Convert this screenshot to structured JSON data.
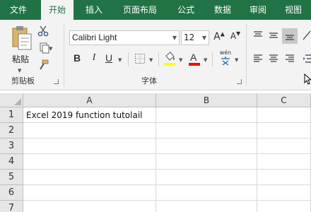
{
  "tabs": [
    {
      "label": "文件",
      "active": false
    },
    {
      "label": "开始",
      "active": true
    },
    {
      "label": "插入",
      "active": false
    },
    {
      "label": "页面布局",
      "active": false
    },
    {
      "label": "公式",
      "active": false
    },
    {
      "label": "数据",
      "active": false
    },
    {
      "label": "审阅",
      "active": false
    },
    {
      "label": "视图",
      "active": false
    }
  ],
  "clipboard": {
    "paste_label": "粘贴",
    "group_label": "剪贴板"
  },
  "font": {
    "family_value": "Calibri Light",
    "size_value": "12",
    "phonetic_label": "wén",
    "group_label": "字体",
    "highlight_color": "#ffff00",
    "font_color": "#ff0000"
  },
  "grid": {
    "columns": [
      "A",
      "B",
      "C"
    ],
    "rows": [
      "1",
      "2",
      "3",
      "4",
      "5",
      "6",
      "7"
    ],
    "cells": {
      "A1": "Excel 2019 function tutolail"
    }
  },
  "colors": {
    "ribbon_green": "#217346",
    "ribbon_bg": "#f3f3f3",
    "header_bg": "#e6e6e6"
  }
}
